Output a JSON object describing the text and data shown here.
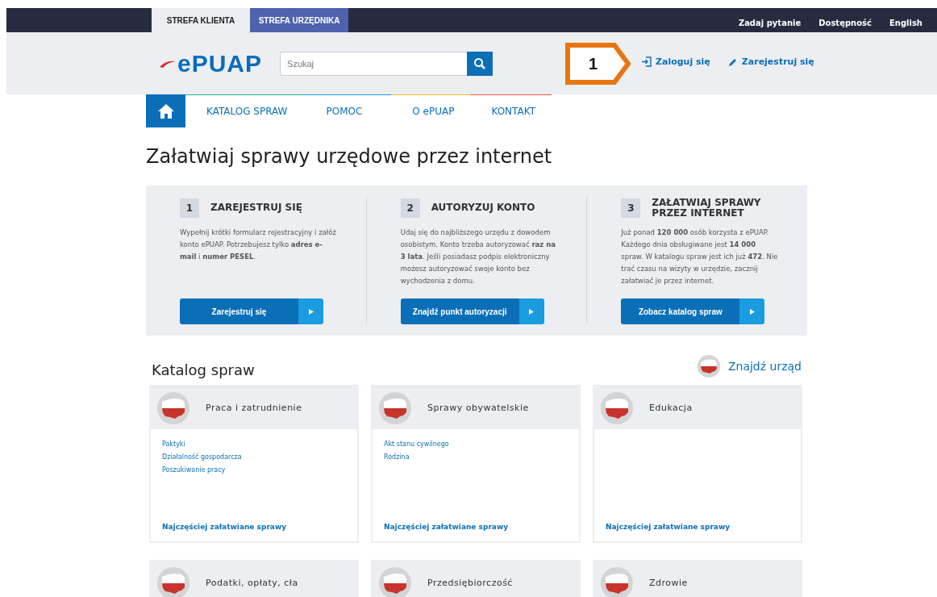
{
  "top_bar": {
    "zones": [
      {
        "label": "STREFA KLIENTA",
        "selected": true
      },
      {
        "label": "STREFA URZĘDNIKA",
        "selected": false
      }
    ],
    "links": [
      "Zadaj pytanie",
      "Dostępność",
      "English"
    ]
  },
  "header": {
    "logo": "ePUAP",
    "search": {
      "placeholder": "Szukaj"
    },
    "callout": "1",
    "login": "Zaloguj się",
    "register": "Zarejestruj się"
  },
  "nav": {
    "items": [
      {
        "label": "KATALOG SPRAW",
        "color": "#1fb58f"
      },
      {
        "label": "POMOC",
        "color": "#1a9ce0"
      },
      {
        "label": "O ePUAP",
        "color": "#f2c12e"
      },
      {
        "label": "KONTAKT",
        "color": "#ec5b3f"
      }
    ]
  },
  "title": "Załatwiaj sprawy urzędowe przez internet",
  "steps": [
    {
      "number": "1",
      "heading": "ZAREJESTRUJ SIĘ",
      "text": "Wypełnij krótki formularz rejestracyjny i załóż konto ePUAP. Potrzebujesz tylko **adres e-mail** i **numer PESEL**.",
      "button": "Zarejestruj się"
    },
    {
      "number": "2",
      "heading": "AUTORYZUJ KONTO",
      "text": "Udaj się do najbliższego urzędu z dowodem osobistym. Konto trzeba autoryzować **raz na 3 lata**. Jeśli posiadasz podpis elektroniczny możesz autoryzować swoje konto bez wychodzenia z domu.",
      "button": "Znajdź punkt autoryzacji"
    },
    {
      "number": "3",
      "heading": "ZAŁATWIAJ SPRAWY PRZEZ INTERNET",
      "text": "Już ponad **120 000** osób korzysta z ePUAP. Każdego dnia obsługiwane jest **14 000** spraw. W katalogu spraw jest ich już **472**. Nie trać czasu na wizyty w urzędzie, zacznij załatwiać je przez internet.",
      "button": "Zobacz katalog spraw"
    }
  ],
  "catalog": {
    "heading": "Katalog spraw",
    "find_office": "Znajdź urząd",
    "categories": [
      {
        "name": "Praca i zatrudnienie",
        "links": [
          "Paktyki",
          "Działalność gospodarcza",
          "Poszukiwanie pracy"
        ],
        "footer": "Najczęściej załatwiane sprawy"
      },
      {
        "name": "Sprawy obywatelskie",
        "links": [
          "Akt stanu cywilnego",
          "Rodzina"
        ],
        "footer": "Najczęściej załatwiane sprawy"
      },
      {
        "name": "Edukacja",
        "footer": "Najczęściej załatwiane sprawy"
      },
      {
        "name": "Podatki, opłaty, cła"
      },
      {
        "name": "Przedsiębiorczość"
      },
      {
        "name": "Zdrowie"
      }
    ]
  }
}
